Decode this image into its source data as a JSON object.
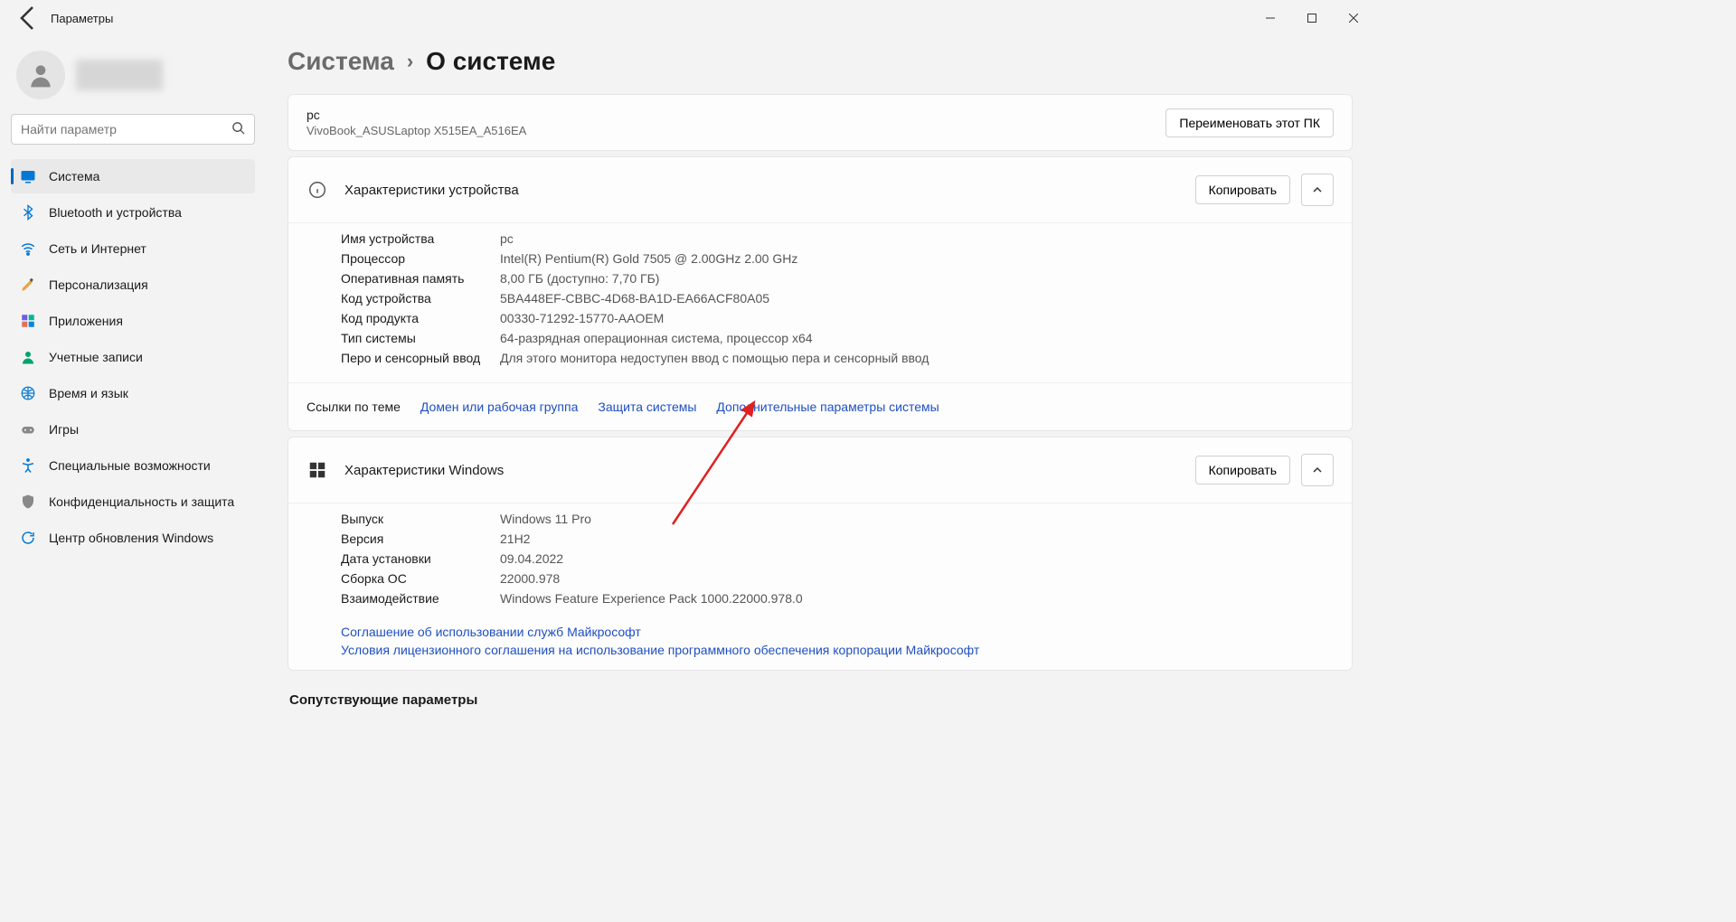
{
  "window": {
    "title": "Параметры"
  },
  "profile": {
    "name_blurred": true
  },
  "search": {
    "placeholder": "Найти параметр"
  },
  "sidebar": {
    "items": [
      {
        "label": "Система",
        "active": true
      },
      {
        "label": "Bluetooth и устройства"
      },
      {
        "label": "Сеть и Интернет"
      },
      {
        "label": "Персонализация"
      },
      {
        "label": "Приложения"
      },
      {
        "label": "Учетные записи"
      },
      {
        "label": "Время и язык"
      },
      {
        "label": "Игры"
      },
      {
        "label": "Специальные возможности"
      },
      {
        "label": "Конфиденциальность и защита"
      },
      {
        "label": "Центр обновления Windows"
      }
    ]
  },
  "breadcrumb": {
    "parent": "Система",
    "current": "О системе"
  },
  "device_card": {
    "name": "pc",
    "model": "VivoBook_ASUSLaptop X515EA_A516EA",
    "rename_btn": "Переименовать этот ПК"
  },
  "device_specs": {
    "title": "Характеристики устройства",
    "copy_btn": "Копировать",
    "rows": [
      {
        "label": "Имя устройства",
        "value": "pc"
      },
      {
        "label": "Процессор",
        "value": "Intel(R) Pentium(R) Gold 7505 @ 2.00GHz   2.00 GHz"
      },
      {
        "label": "Оперативная память",
        "value": "8,00 ГБ (доступно: 7,70 ГБ)"
      },
      {
        "label": "Код устройства",
        "value": "5BA448EF-CBBC-4D68-BA1D-EA66ACF80A05"
      },
      {
        "label": "Код продукта",
        "value": "00330-71292-15770-AAOEM"
      },
      {
        "label": "Тип системы",
        "value": "64-разрядная операционная система, процессор x64"
      },
      {
        "label": "Перо и сенсорный ввод",
        "value": "Для этого монитора недоступен ввод с помощью пера и сенсорный ввод"
      }
    ]
  },
  "related_links": {
    "label": "Ссылки по теме",
    "items": [
      "Домен или рабочая группа",
      "Защита системы",
      "Дополнительные параметры системы"
    ]
  },
  "windows_specs": {
    "title": "Характеристики Windows",
    "copy_btn": "Копировать",
    "rows": [
      {
        "label": "Выпуск",
        "value": "Windows 11 Pro"
      },
      {
        "label": "Версия",
        "value": "21H2"
      },
      {
        "label": "Дата установки",
        "value": "09.04.2022"
      },
      {
        "label": "Сборка ОС",
        "value": "22000.978"
      },
      {
        "label": "Взаимодействие",
        "value": "Windows Feature Experience Pack 1000.22000.978.0"
      }
    ],
    "links": [
      "Соглашение об использовании служб Майкрософт",
      "Условия лицензионного соглашения на использование программного обеспечения корпорации Майкрософт"
    ]
  },
  "related_heading": "Сопутствующие параметры"
}
